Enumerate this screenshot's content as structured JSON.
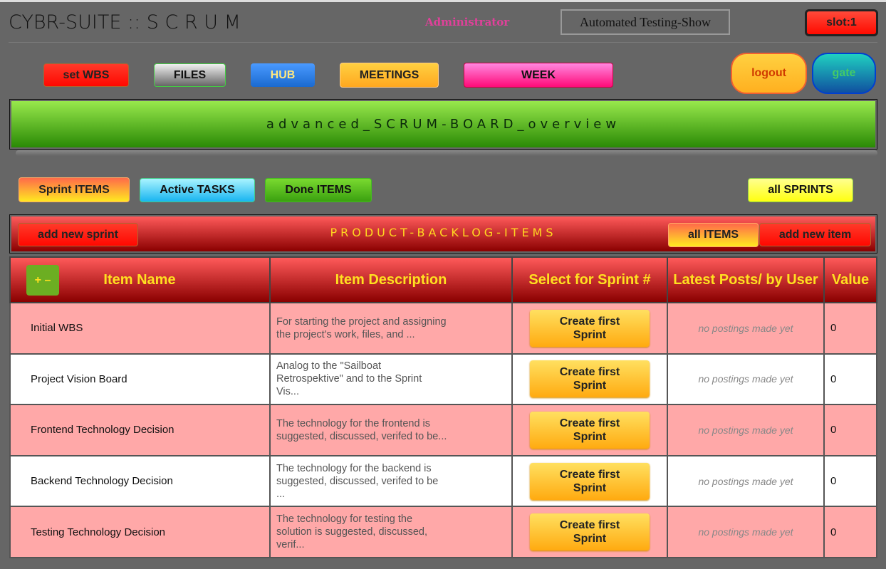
{
  "header": {
    "title": "CYBR-SUITE :: S C R U M",
    "role": "Administrator",
    "project": "Automated Testing-Show",
    "slot": "slot:1"
  },
  "nav": [
    {
      "label": "set WBS",
      "color": "#ff1a0a"
    },
    {
      "label": "FILES",
      "color": "#bbbbbb"
    },
    {
      "label": "HUB",
      "color": "#2a7ae0"
    },
    {
      "label": "MEETINGS",
      "color": "#ffb830"
    },
    {
      "label": "WEEK",
      "color": "#ff2a98"
    }
  ],
  "auth": {
    "logout": "logout",
    "gate": "gate"
  },
  "banner": "advanced_SCRUM-BOARD_overview",
  "filters": {
    "sprint_items": "Sprint ITEMS",
    "active_tasks": "Active TASKS",
    "done_items": "Done ITEMS",
    "all_sprints": "all SPRINTS"
  },
  "backlog": {
    "title": "PRODUCT-BACKLOG-ITEMS",
    "add_sprint": "add new sprint",
    "all_items": "all ITEMS",
    "add_item": "add new item"
  },
  "table": {
    "toggle": "+ –",
    "columns": [
      "Item Name",
      "Item Description",
      "Select for Sprint #",
      "Latest Posts/ by User",
      "Value"
    ],
    "rows": [
      {
        "name": "Initial WBS",
        "description": "For starting the project and assigning the project's work, files, and ...",
        "action": "Create first Sprint",
        "posts": "no postings made yet",
        "value": "0"
      },
      {
        "name": "Project Vision Board",
        "description": "Analog to the \"Sailboat Retrospektive\" and to the Sprint Vis...",
        "action": "Create first Sprint",
        "posts": "no postings made yet",
        "value": "0"
      },
      {
        "name": "Frontend Technology Decision",
        "description": "The technology for the frontend is suggested, discussed, verifed to be...",
        "action": "Create first Sprint",
        "posts": "no postings made yet",
        "value": "0"
      },
      {
        "name": "Backend Technology Decision",
        "description": "The technology for the backend is suggested, discussed, verifed to be ...",
        "action": "Create first Sprint",
        "posts": "no postings made yet",
        "value": "0"
      },
      {
        "name": "Testing Technology Decision",
        "description": "The technology for testing the solution is suggested, discussed, verif...",
        "action": "Create first Sprint",
        "posts": "no postings made yet",
        "value": "0"
      }
    ]
  }
}
